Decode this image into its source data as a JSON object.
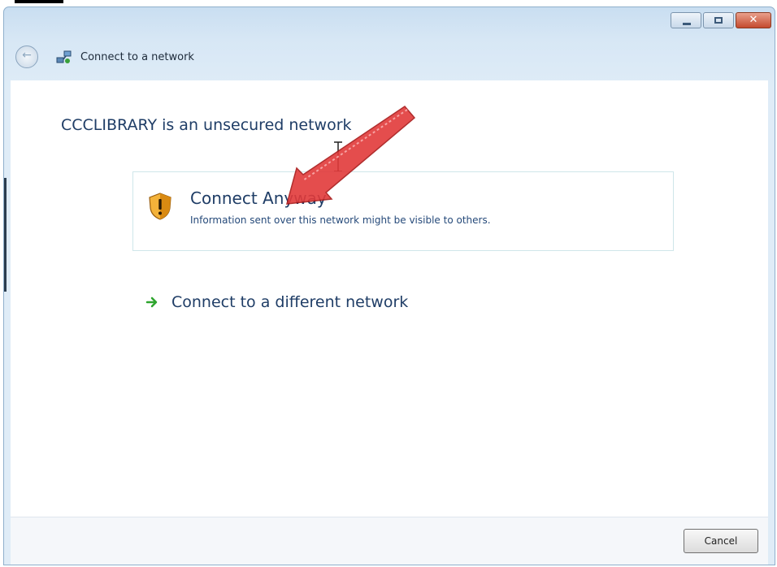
{
  "window": {
    "title": "Connect to a network",
    "controls": [
      "minimize-button",
      "maximize-button",
      "close-button"
    ]
  },
  "main": {
    "heading": "CCCLIBRARY is an unsecured network",
    "options": [
      {
        "title": "Connect Anyway",
        "description": "Information sent over this network might be visible to others.",
        "icon": "shield-warning-icon"
      }
    ],
    "link": {
      "label": "Connect to a different network",
      "icon": "green-arrow-icon"
    }
  },
  "footer": {
    "cancel_label": "Cancel"
  },
  "colors": {
    "titlebar": "#d7e7f5",
    "heading_text": "#1f3d66",
    "annotation_arrow": "#e23a3a",
    "link_arrow": "#2ea52e",
    "close_button": "#c44a2e"
  }
}
